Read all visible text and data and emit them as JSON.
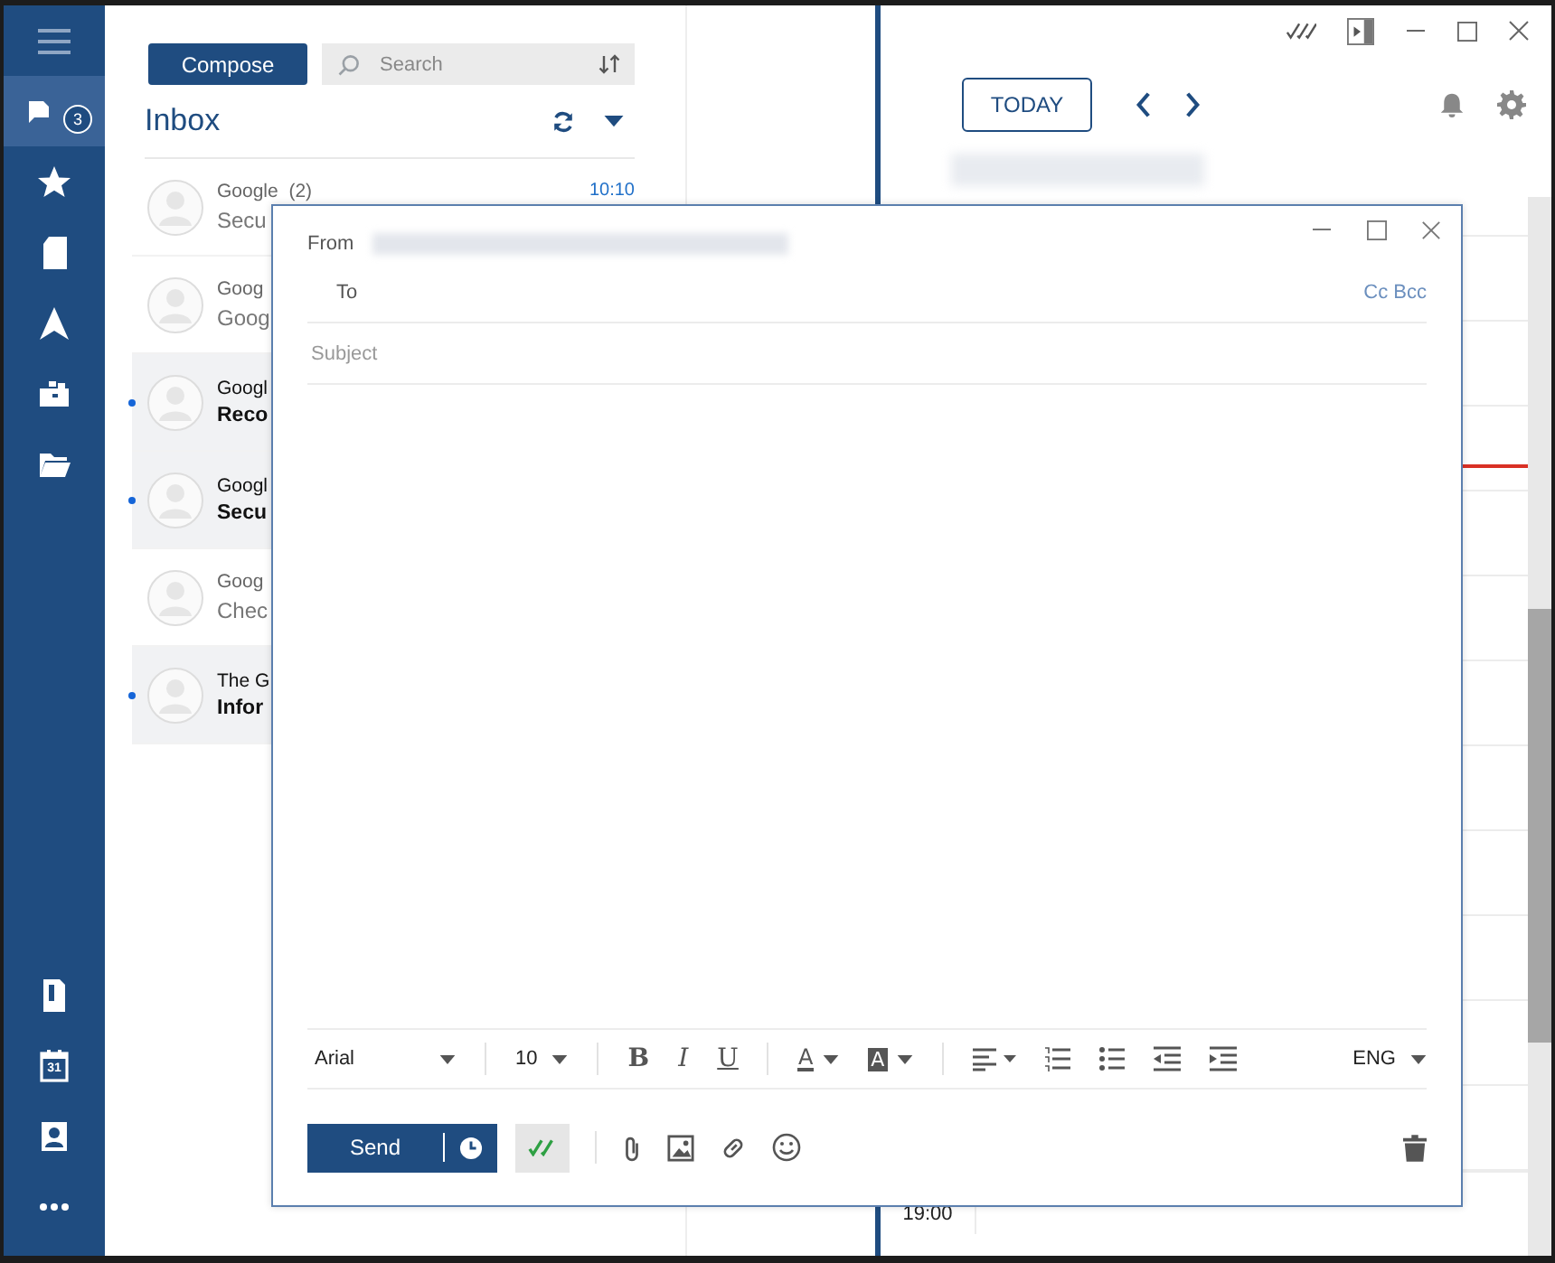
{
  "sidebar": {
    "top": [
      {
        "kind": "menu",
        "selected": false
      },
      {
        "kind": "inbox",
        "badge": "3",
        "selected": true
      },
      {
        "kind": "star",
        "selected": false
      },
      {
        "kind": "document",
        "selected": false
      },
      {
        "kind": "send",
        "selected": false
      },
      {
        "kind": "toolbox",
        "selected": false
      },
      {
        "kind": "folder",
        "selected": false
      }
    ],
    "bottom": [
      {
        "kind": "note",
        "selected": false
      },
      {
        "kind": "calendar",
        "label": "31",
        "selected": false
      },
      {
        "kind": "contacts",
        "selected": false
      },
      {
        "kind": "more",
        "selected": false
      }
    ]
  },
  "mail": {
    "compose": "Compose",
    "search": {
      "placeholder": "Search"
    },
    "title": "Inbox",
    "messages": [
      {
        "sender": "Google  (2)",
        "subject": "Secu",
        "time": "10:10",
        "unread": false
      },
      {
        "sender": "Goog",
        "subject": "Goog",
        "unread": false
      },
      {
        "sender": "Googl",
        "subject": "Reco",
        "unread": true
      },
      {
        "sender": "Googl",
        "subject": "Secu",
        "unread": true
      },
      {
        "sender": "Goog",
        "subject": "Chec",
        "unread": false
      },
      {
        "sender": "The G",
        "subject": "Infor",
        "unread": true
      }
    ]
  },
  "calendar": {
    "today": "TODAY",
    "hour_label": "19:00"
  },
  "compose": {
    "from_label": "From",
    "to_label": "To",
    "cc_bcc": "Cc Bcc",
    "subject": {
      "placeholder": "Subject"
    },
    "font": "Arial",
    "size": "10",
    "format_buttons": [
      {
        "kind": "bold",
        "label": "B"
      },
      {
        "kind": "italic",
        "label": "I"
      },
      {
        "kind": "underline",
        "label": "U"
      },
      {
        "kind": "text_color",
        "label": "A"
      },
      {
        "kind": "highlight",
        "label": "A"
      }
    ],
    "language": "ENG",
    "send": "Send"
  }
}
